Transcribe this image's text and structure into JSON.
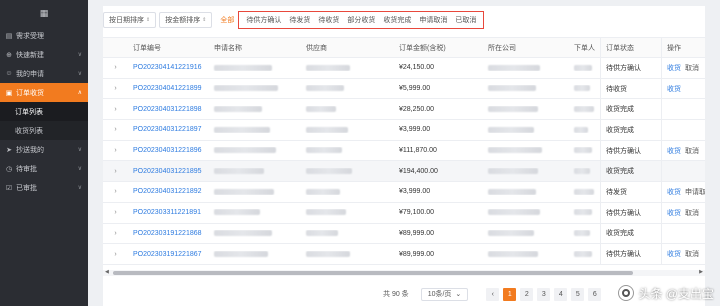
{
  "sidebar": {
    "items": [
      {
        "label": "需求受理",
        "icon": "document-icon",
        "arrow": ""
      },
      {
        "label": "快速新建",
        "icon": "plus-icon",
        "arrow": "∨"
      },
      {
        "label": "我的申请",
        "icon": "person-icon",
        "arrow": "∨"
      },
      {
        "label": "订单收货",
        "icon": "cart-icon",
        "arrow": "∧",
        "active": true
      },
      {
        "label": "抄送我的",
        "icon": "send-icon",
        "arrow": "∨"
      },
      {
        "label": "待审批",
        "icon": "clock-icon",
        "arrow": "∨"
      },
      {
        "label": "已审批",
        "icon": "check-icon",
        "arrow": "∨"
      }
    ],
    "subitems": [
      {
        "label": "订单列表",
        "active": true
      },
      {
        "label": "收货列表",
        "active": false
      }
    ]
  },
  "filters": {
    "sort_date": "按日期排序",
    "sort_amount": "按金额排序",
    "all": "全部",
    "status_tabs": [
      "待供方确认",
      "待发货",
      "待收货",
      "部分收货",
      "收货完成",
      "申请取消",
      "已取消"
    ]
  },
  "table": {
    "headers": {
      "no": "订单编号",
      "name": "申请名称",
      "supplier": "供应商",
      "amount": "订单金额(含税)",
      "company": "所在公司",
      "user": "下单人",
      "status": "订单状态",
      "op": "操作"
    },
    "rows": [
      {
        "no": "PO202304141221916",
        "amount": "¥24,150.00",
        "status": "待供方确认",
        "op1": "收货",
        "op2": "取消"
      },
      {
        "no": "PO202304041221899",
        "amount": "¥5,999.00",
        "status": "待收货",
        "op1": "收货",
        "op2": ""
      },
      {
        "no": "PO202304031221898",
        "amount": "¥28,250.00",
        "status": "收货完成",
        "op1": "",
        "op2": ""
      },
      {
        "no": "PO202304031221897",
        "amount": "¥3,999.00",
        "status": "收货完成",
        "op1": "",
        "op2": ""
      },
      {
        "no": "PO202304031221896",
        "amount": "¥111,870.00",
        "status": "待供方确认",
        "op1": "收货",
        "op2": "取消"
      },
      {
        "no": "PO202304031221895",
        "amount": "¥194,400.00",
        "status": "收货完成",
        "op1": "",
        "op2": ""
      },
      {
        "no": "PO202304031221892",
        "amount": "¥3,999.00",
        "status": "待发货",
        "op1": "收货",
        "op2": "申请取消"
      },
      {
        "no": "PO202303311221891",
        "amount": "¥79,100.00",
        "status": "待供方确认",
        "op1": "收货",
        "op2": "取消"
      },
      {
        "no": "PO202303191221868",
        "amount": "¥89,999.00",
        "status": "收货完成",
        "op1": "",
        "op2": ""
      },
      {
        "no": "PO202303191221867",
        "amount": "¥89,999.00",
        "status": "待供方确认",
        "op1": "收货",
        "op2": "取消"
      }
    ]
  },
  "pager": {
    "total": "共 90 条",
    "size": "10条/页",
    "pages": [
      "1",
      "2",
      "3",
      "4",
      "5",
      "6"
    ],
    "current": "1"
  },
  "watermark": {
    "text": "头条 @支出宝"
  }
}
